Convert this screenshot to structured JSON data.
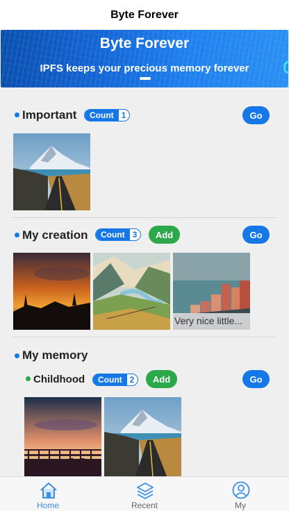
{
  "app": {
    "title": "Byte Forever"
  },
  "banner": {
    "title": "Byte Forever",
    "subtitle": "IPFS keeps your precious memory forever"
  },
  "sections": {
    "important": {
      "title": "Important",
      "count_label": "Count",
      "count": "1",
      "go_label": "Go"
    },
    "creation": {
      "title": "My creation",
      "count_label": "Count",
      "count": "3",
      "add_label": "Add",
      "go_label": "Go",
      "caption": "Very nice little..."
    },
    "memory": {
      "title": "My memory",
      "childhood": {
        "title": "Childhood",
        "count_label": "Count",
        "count": "2",
        "add_label": "Add",
        "go_label": "Go"
      }
    }
  },
  "tabbar": {
    "home": "Home",
    "recent": "Recent",
    "my": "My"
  },
  "colors": {
    "primary": "#1677e6",
    "add_green": "#2aa84a",
    "active_tab": "#3a8ee6",
    "background": "#efefef"
  },
  "icons": {
    "home": "home-icon",
    "recent": "layers-icon",
    "my": "user-icon"
  }
}
